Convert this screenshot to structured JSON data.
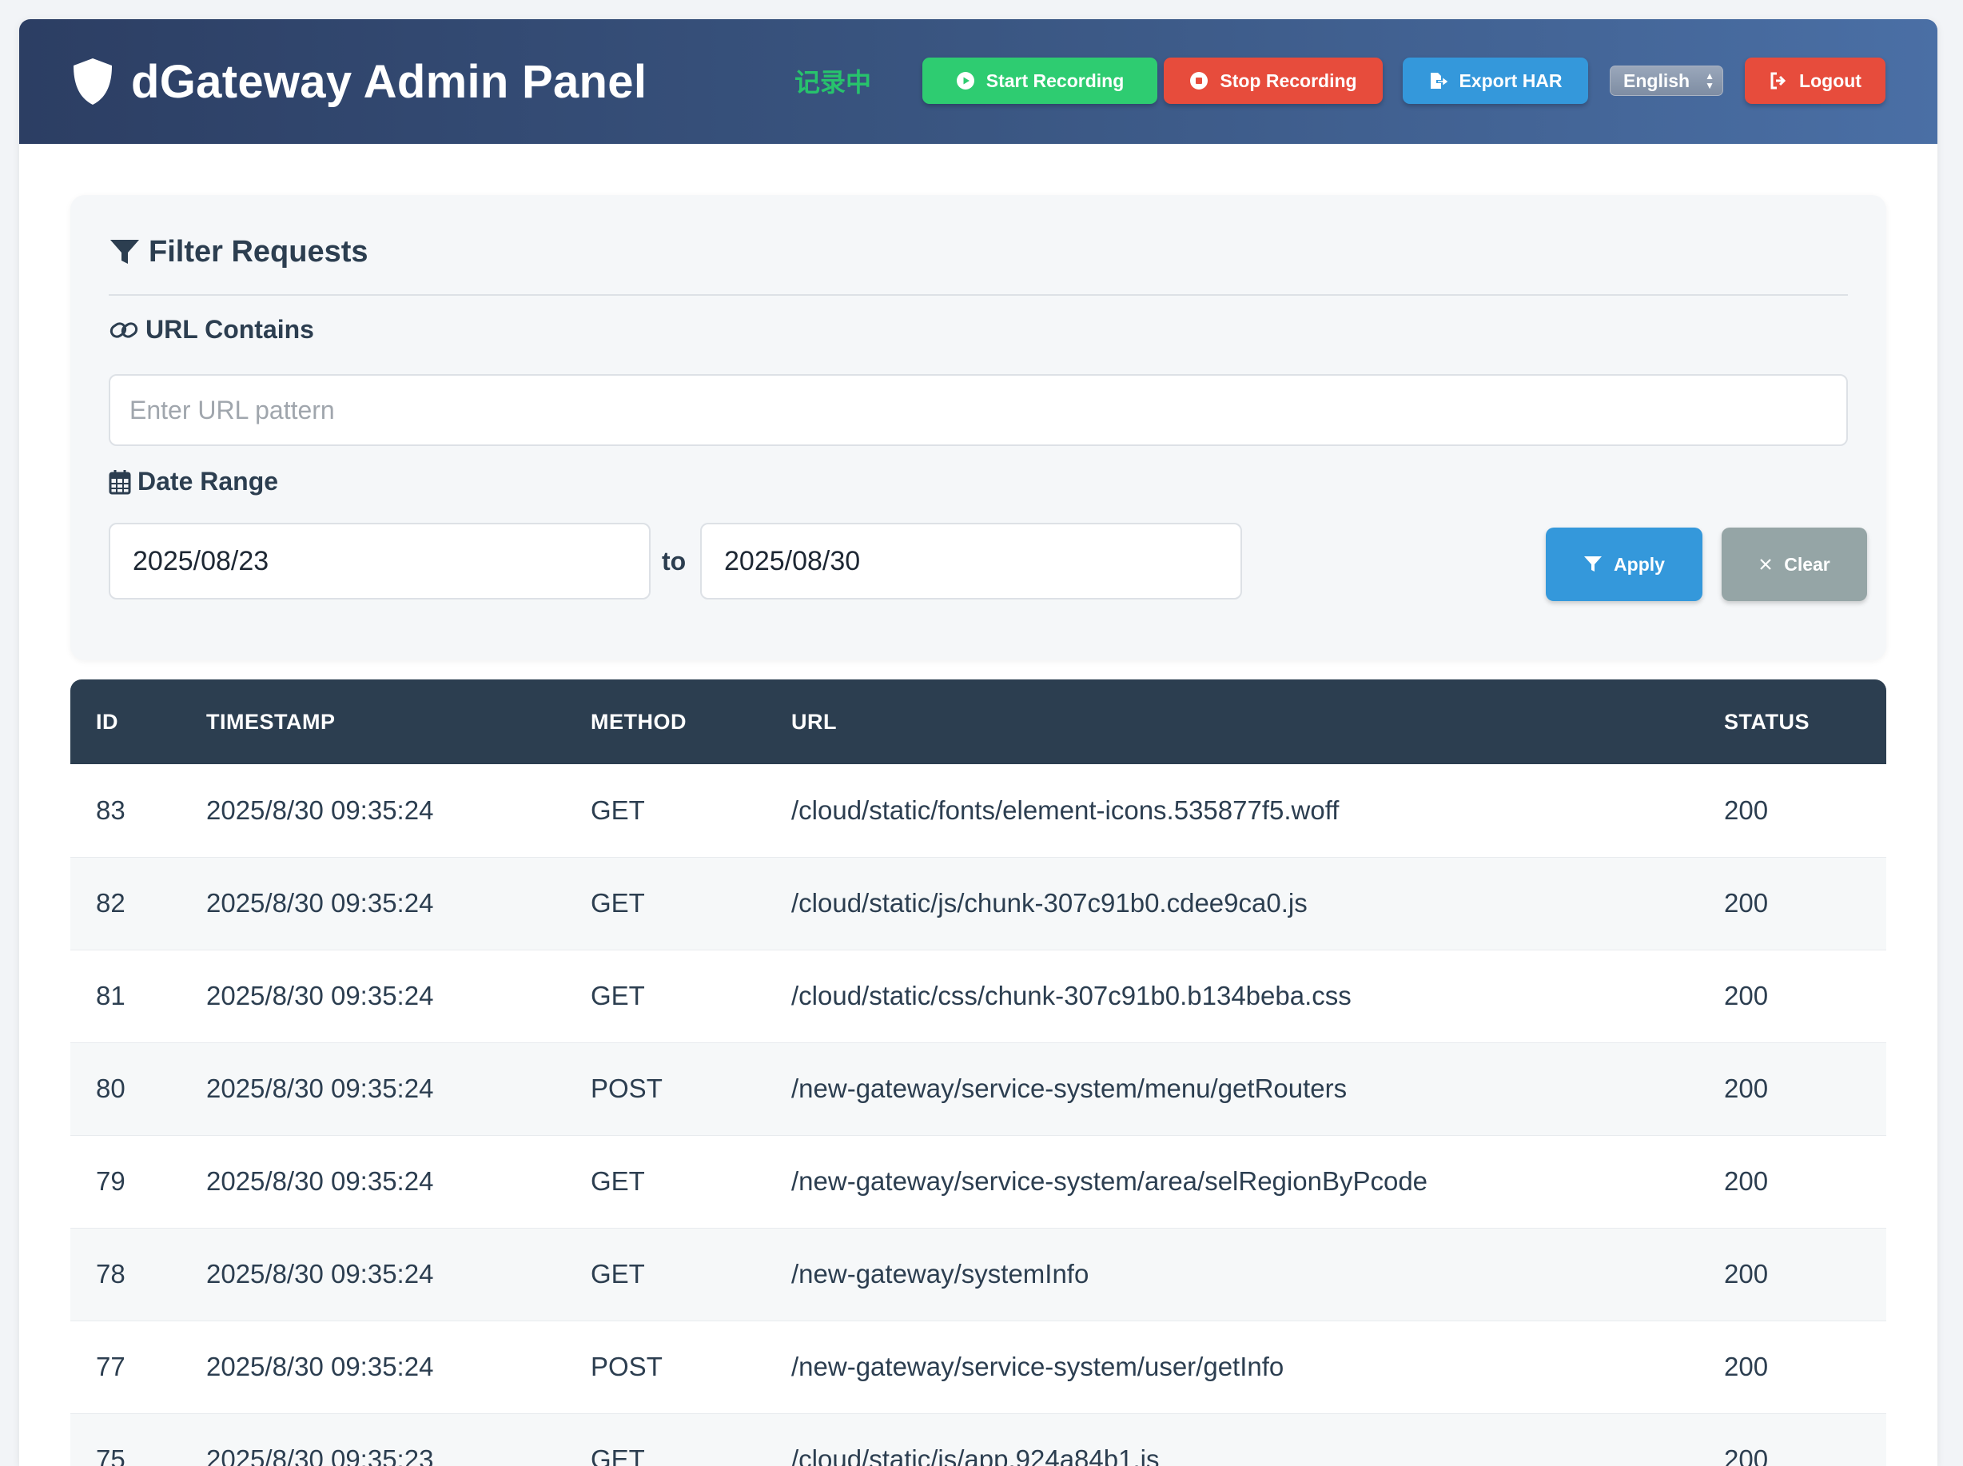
{
  "header": {
    "title": "dGateway Admin Panel",
    "recording_status": "记录中",
    "start_label": "Start Recording",
    "stop_label": "Stop Recording",
    "export_label": "Export HAR",
    "language": "English",
    "logout_label": "Logout",
    "colors": {
      "start": "#2ecc71",
      "stop": "#e74c3c",
      "export": "#3498db",
      "logout": "#e74c3c",
      "status": "#27c36c"
    }
  },
  "filter": {
    "title": "Filter Requests",
    "url_label": "URL Contains",
    "url_placeholder": "Enter URL pattern",
    "url_value": "",
    "date_label": "Date Range",
    "date_from": "2025/08/23",
    "date_to": "2025/08/30",
    "to_label": "to",
    "apply_label": "Apply",
    "clear_label": "Clear"
  },
  "table": {
    "columns": [
      "ID",
      "TIMESTAMP",
      "METHOD",
      "URL",
      "STATUS"
    ],
    "rows": [
      [
        "83",
        "2025/8/30 09:35:24",
        "GET",
        "/cloud/static/fonts/element-icons.535877f5.woff",
        "200"
      ],
      [
        "82",
        "2025/8/30 09:35:24",
        "GET",
        "/cloud/static/js/chunk-307c91b0.cdee9ca0.js",
        "200"
      ],
      [
        "81",
        "2025/8/30 09:35:24",
        "GET",
        "/cloud/static/css/chunk-307c91b0.b134beba.css",
        "200"
      ],
      [
        "80",
        "2025/8/30 09:35:24",
        "POST",
        "/new-gateway/service-system/menu/getRouters",
        "200"
      ],
      [
        "79",
        "2025/8/30 09:35:24",
        "GET",
        "/new-gateway/service-system/area/selRegionByPcode",
        "200"
      ],
      [
        "78",
        "2025/8/30 09:35:24",
        "GET",
        "/new-gateway/systemInfo",
        "200"
      ],
      [
        "77",
        "2025/8/30 09:35:24",
        "POST",
        "/new-gateway/service-system/user/getInfo",
        "200"
      ],
      [
        "75",
        "2025/8/30 09:35:23",
        "GET",
        "/cloud/static/js/app.924a84b1.js",
        "200"
      ]
    ]
  }
}
